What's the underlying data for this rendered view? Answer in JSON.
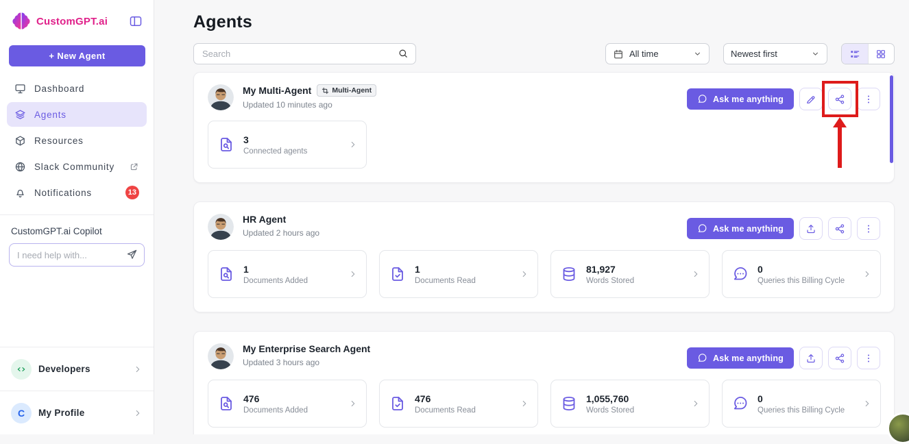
{
  "sidebar": {
    "logo_text": "CustomGPT.ai",
    "new_agent_label": "+  New Agent",
    "nav": [
      {
        "label": "Dashboard",
        "icon": "dashboard",
        "name": "dashboard"
      },
      {
        "label": "Agents",
        "icon": "layers",
        "name": "agents",
        "active": true
      },
      {
        "label": "Resources",
        "icon": "cube",
        "name": "resources"
      },
      {
        "label": "Slack Community",
        "icon": "globe",
        "name": "slack-community",
        "trailing": "external"
      },
      {
        "label": "Notifications",
        "icon": "bell",
        "name": "notifications",
        "badge": "13"
      }
    ],
    "copilot": {
      "title": "CustomGPT.ai Copilot",
      "placeholder": "I need help with..."
    },
    "footer": [
      {
        "label": "Developers",
        "icon": "code",
        "name": "developers"
      },
      {
        "label": "My Profile",
        "avatar_letter": "C",
        "name": "my-profile"
      }
    ]
  },
  "header": {
    "title": "Agents",
    "search_placeholder": "Search",
    "time_filter": "All time",
    "sort_filter": "Newest first"
  },
  "agents": [
    {
      "name": "My Multi-Agent",
      "badge": "Multi-Agent",
      "updated": "Updated 10 minutes ago",
      "ask_label": "Ask me anything",
      "actions": [
        "edit",
        "share",
        "more"
      ],
      "has_scroll_indicator": true,
      "stats": [
        {
          "icon": "doc-search",
          "value": "3",
          "label": "Connected agents"
        }
      ]
    },
    {
      "name": "HR Agent",
      "updated": "Updated 2 hours ago",
      "ask_label": "Ask me anything",
      "actions": [
        "upload",
        "share",
        "more"
      ],
      "stats": [
        {
          "icon": "doc-search",
          "value": "1",
          "label": "Documents Added"
        },
        {
          "icon": "doc-check",
          "value": "1",
          "label": "Documents Read"
        },
        {
          "icon": "database",
          "value": "81,927",
          "label": "Words Stored"
        },
        {
          "icon": "chat-dots",
          "value": "0",
          "label": "Queries this Billing Cycle"
        }
      ]
    },
    {
      "name": "My Enterprise Search Agent",
      "updated": "Updated 3 hours ago",
      "ask_label": "Ask me anything",
      "actions": [
        "upload",
        "share",
        "more"
      ],
      "stats": [
        {
          "icon": "doc-search",
          "value": "476",
          "label": "Documents Added"
        },
        {
          "icon": "doc-check",
          "value": "476",
          "label": "Documents Read"
        },
        {
          "icon": "database",
          "value": "1,055,760",
          "label": "Words Stored"
        },
        {
          "icon": "chat-dots",
          "value": "0",
          "label": "Queries this Billing Cycle"
        }
      ]
    }
  ],
  "annotation": {
    "highlighted_element": "share-button on first agent card",
    "shape": "red box with upward arrow"
  },
  "colors": {
    "accent": "#6A5BE2",
    "logo_pink": "#E0218A",
    "badge_red": "#EF4444",
    "annotation_red": "#DE1B1B"
  }
}
